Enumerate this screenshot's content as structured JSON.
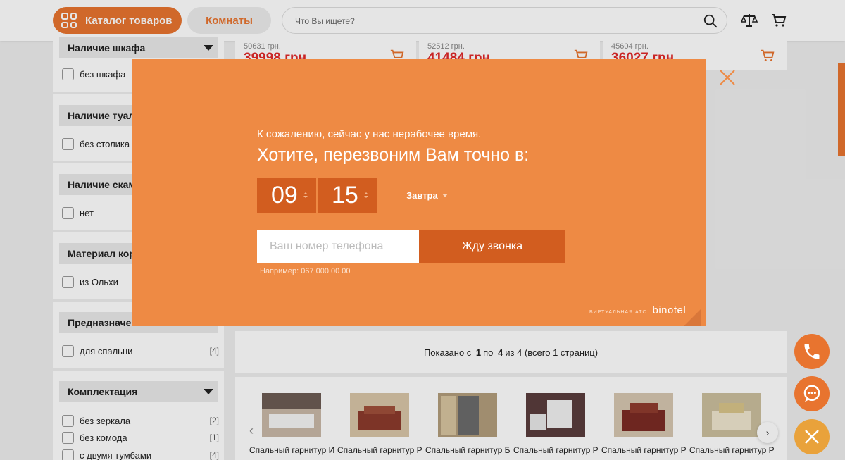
{
  "header": {
    "catalog_label": "Каталог товаров",
    "rooms_label": "Комнаты",
    "search_placeholder": "Что Вы ищете?"
  },
  "filters": [
    {
      "title": "Наличие шкафа",
      "options": [
        {
          "label": "без шкафа",
          "count": ""
        }
      ]
    },
    {
      "title": "Наличие туалетного столика",
      "options": [
        {
          "label": "без столика",
          "count": ""
        }
      ]
    },
    {
      "title": "Наличие скамьи/банкетки",
      "options": [
        {
          "label": "нет",
          "count": ""
        }
      ]
    },
    {
      "title": "Материал корпуса",
      "options": [
        {
          "label": "из Ольхи",
          "count": ""
        }
      ]
    },
    {
      "title": "Предназначение",
      "options": [
        {
          "label": "для спальни",
          "count": "[4]"
        }
      ]
    },
    {
      "title": "Комплектация",
      "options": [
        {
          "label": "без зеркала",
          "count": "[2]"
        },
        {
          "label": "без комода",
          "count": "[1]"
        },
        {
          "label": "с двумя тумбами",
          "count": "[4]"
        }
      ]
    }
  ],
  "products": [
    {
      "old_price": "50631 грн.",
      "price": "39998 грн."
    },
    {
      "old_price": "52512 грн.",
      "price": "41484 грн."
    },
    {
      "old_price": "45604 грн.",
      "price": "36027 грн."
    }
  ],
  "pagination": {
    "prefix": "Показано с",
    "from": "1",
    "to_word": "по",
    "to": "4",
    "of_word": "из 4 (всего 1 страниц)"
  },
  "carousel": [
    {
      "label": "Спальный гарнитур Интелия",
      "color": "#c9b8a8"
    },
    {
      "label": "Спальный гарнитур Реджина Перо",
      "color": "#8c3a2c"
    },
    {
      "label": "Спальный гарнитур Бланка",
      "color": "#b39e7c"
    },
    {
      "label": "Спальный гарнитур Рома белый глянец",
      "color": "#5a3d3d"
    },
    {
      "label": "Спальный гарнитур Росарио Перо",
      "color": "#7b2b24"
    },
    {
      "label": "Спальный гарнитур Реджина белый",
      "color": "#ddd2b8"
    }
  ],
  "modal": {
    "subtitle": "К сожалению, сейчас у нас нерабочее время.",
    "title": "Хотите, перезвоним Вам точно в:",
    "hour": "09",
    "minute": "15",
    "day": "Завтра",
    "phone_placeholder": "Ваш номер телефона",
    "submit_label": "Жду звонка",
    "example": "Например: 067 000 00 00",
    "brand_caption": "ВИРТУАЛЬНАЯ АТС",
    "brand_name": "binotel"
  },
  "colors": {
    "accent": "#e8742f",
    "modal_bg": "#ee8a44",
    "modal_dark": "#d25d1f",
    "price_red": "#e02a2a"
  },
  "icons": [
    "grid-icon",
    "search-icon",
    "compare-icon",
    "cart-icon",
    "close-icon",
    "phone-icon",
    "chat-icon"
  ]
}
